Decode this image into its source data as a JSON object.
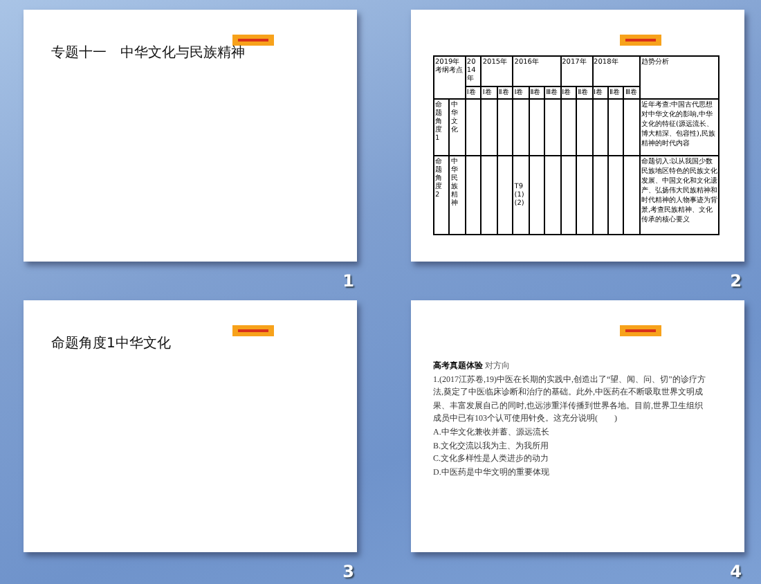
{
  "slides": [
    {
      "kind": "title",
      "number": "1",
      "title": "专题十一　中华文化与民族精神"
    },
    {
      "kind": "table",
      "number": "2",
      "table": {
        "corner": "2019年考纲考点",
        "years": [
          {
            "label": "2014年",
            "papers": [
              "Ⅰ卷"
            ]
          },
          {
            "label": "2015年",
            "papers": [
              "Ⅰ卷",
              "Ⅱ卷"
            ]
          },
          {
            "label": "2016年",
            "papers": [
              "Ⅰ卷",
              "Ⅱ卷",
              "Ⅲ卷"
            ]
          },
          {
            "label": "2017年",
            "papers": [
              "Ⅰ卷",
              "Ⅱ卷"
            ]
          },
          {
            "label": "2018年",
            "papers": [
              "Ⅰ卷",
              "Ⅱ卷",
              "Ⅲ卷"
            ]
          }
        ],
        "analysis_header": "趋势分析",
        "rows": [
          {
            "topic": "命题角度1",
            "point": "中华文化",
            "cells": [
              null,
              null,
              null,
              null,
              null,
              null,
              null,
              null,
              null,
              null,
              null
            ],
            "analysis": "近年考查:中国古代思想对中华文化的影响,中华文化的特征(源远流长、博大精深、包容性),民族精神的时代内容"
          },
          {
            "topic": "命题角度2",
            "point": "中华民族精神",
            "cells": [
              null,
              null,
              null,
              "T9(1)(2)",
              null,
              null,
              null,
              null,
              null,
              null,
              null
            ],
            "analysis": "命题切入:以从我国少数民族地区特色的民族文化发展、中国文化和文化遗产、弘扬伟大民族精神和时代精神的人物事迹为背景,考查民族精神、文化传承的核心要义"
          }
        ]
      }
    },
    {
      "kind": "title",
      "number": "3",
      "title": "命题角度1中华文化"
    },
    {
      "kind": "question",
      "number": "4",
      "heading": "高考真题体验",
      "subheading": "对方向",
      "question": "1.(2017江苏卷,19)中医在长期的实践中,创造出了“望、闻、问、切”的诊疗方法,奠定了中医临床诊断和治疗的基础。此外,中医药在不断吸取世界文明成果、丰富发展自己的同时,也远涉重洋传播到世界各地。目前,世界卫生组织成员中已有103个认可使用针灸。这充分说明(　　)",
      "options": [
        "A.中华文化兼收并蓄、源远流长",
        "B.文化交流以我为主、为我所用",
        "C.文化多样性是人类进步的动力",
        "D.中医药是中华文明的重要体现"
      ]
    }
  ]
}
